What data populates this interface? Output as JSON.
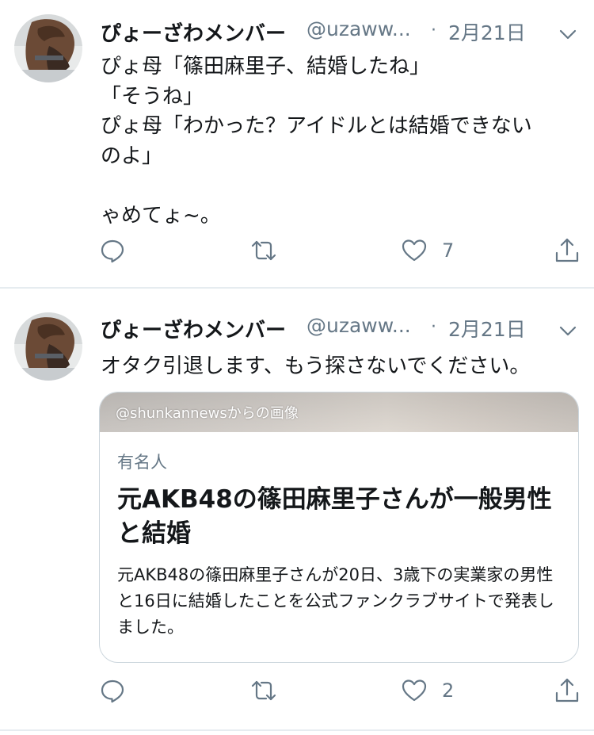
{
  "tweets": [
    {
      "author_name": "ぴょーざわメンバー",
      "handle": "@uzaww...",
      "separator": "·",
      "date": "2月21日",
      "lines": [
        "ぴょ母「篠田麻里子、結婚したね」",
        "「そうね」",
        "ぴょ母「わかった？アイドルとは結婚できない",
        "のよ」",
        "",
        "ゃめてょ~。"
      ],
      "like_count": "7"
    },
    {
      "author_name": "ぴょーざわメンバー",
      "handle": "@uzaww...",
      "separator": "·",
      "date": "2月21日",
      "text": "オタク引退します、もう探さないでください。",
      "card": {
        "image_credit": "@shunkannewsからの画像",
        "category": "有名人",
        "title": "元AKB48の篠田麻里子さんが一般男性と結婚",
        "description": "元AKB48の篠田麻里子さんが20日、3歳下の実業家の男性と16日に結婚したことを公式ファンクラブサイトで発表しました。"
      },
      "like_count": "2"
    }
  ],
  "icons": {
    "reply": "reply-icon",
    "retweet": "retweet-icon",
    "like": "heart-icon",
    "share": "share-icon",
    "more": "chevron-down-icon"
  },
  "colors": {
    "secondary_text": "#657786",
    "divider": "#e6ecf0",
    "text": "#14171a"
  }
}
